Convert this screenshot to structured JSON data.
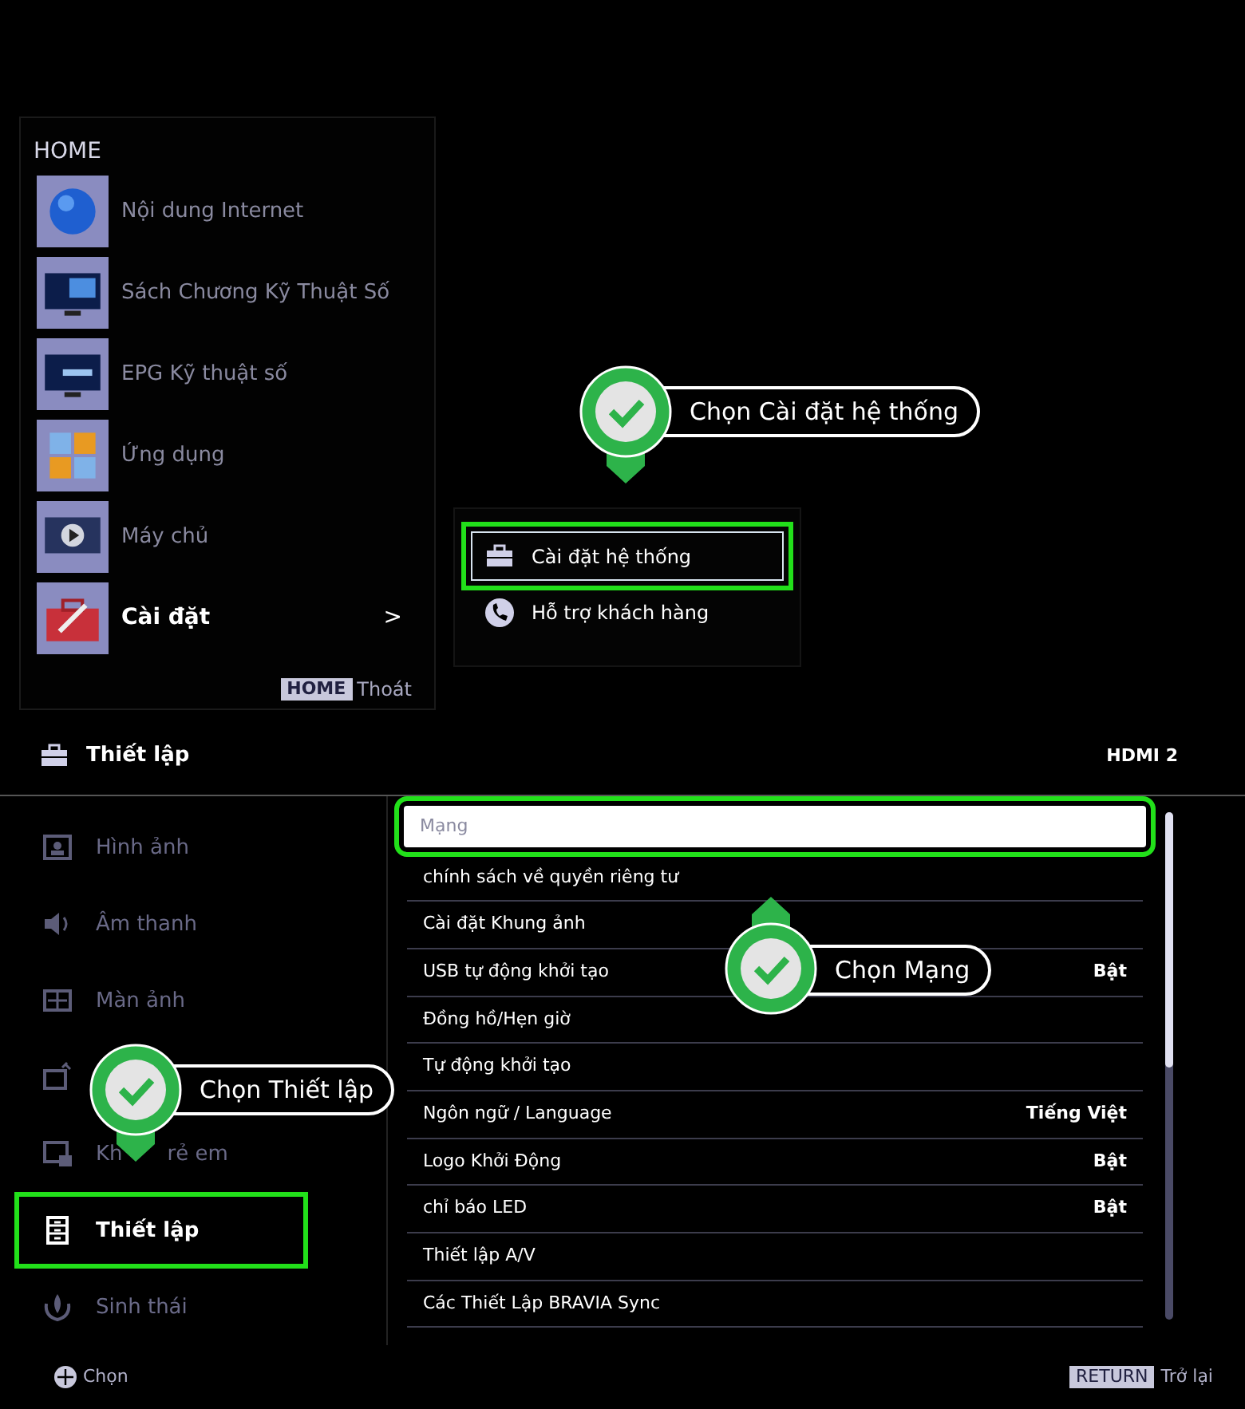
{
  "home_menu": {
    "title": "HOME",
    "items": [
      {
        "label": "Nội dung Internet",
        "selected": false
      },
      {
        "label": "Sách Chương Kỹ Thuật Số",
        "selected": false
      },
      {
        "label": "EPG Kỹ thuật số",
        "selected": false
      },
      {
        "label": "Ứng dụng",
        "selected": false
      },
      {
        "label": "Máy chủ",
        "selected": false
      },
      {
        "label": "Cài đặt",
        "selected": true,
        "chevron": ">"
      }
    ],
    "hint": {
      "key": "HOME",
      "label": "Thoát"
    }
  },
  "submenu": {
    "items": [
      {
        "label": "Cài đặt hệ thống",
        "selected": true,
        "highlighted": true
      },
      {
        "label": "Hỗ trợ khách hàng",
        "selected": false,
        "highlighted": false
      }
    ]
  },
  "settings": {
    "title": "Thiết lập",
    "input": "HDMI 2",
    "sidebar": [
      {
        "label_parts": [
          "Hình ảnh"
        ],
        "selected": false,
        "highlighted": false
      },
      {
        "label_parts": [
          "Âm thanh"
        ],
        "selected": false,
        "highlighted": false
      },
      {
        "label_parts": [
          "Màn ảnh"
        ],
        "selected": false,
        "highlighted": false
      },
      {
        "selected": false,
        "highlighted": false
      },
      {
        "label_parts": [
          "Kh",
          "rẻ em"
        ],
        "selected": false,
        "highlighted": false
      },
      {
        "label_parts": [
          "Thiết lập"
        ],
        "selected": true,
        "highlighted": true
      },
      {
        "label_parts": [
          "Sinh thái"
        ],
        "selected": false,
        "highlighted": false
      }
    ],
    "rows": [
      {
        "label": "Mạng",
        "selected": true,
        "highlighted": true
      },
      {
        "label": "chính sách về quyền riêng tư",
        "selected": false,
        "highlighted": false
      },
      {
        "label": "Cài đặt Khung ảnh",
        "selected": false,
        "highlighted": false
      },
      {
        "label": "USB tự động khởi tạo",
        "value": "Bật",
        "selected": false,
        "highlighted": false
      },
      {
        "label": "Đồng hồ/Hẹn giờ",
        "selected": false,
        "highlighted": false
      },
      {
        "label": "Tự động khởi tạo",
        "selected": false,
        "highlighted": false
      },
      {
        "label": "Ngôn ngữ / Language",
        "value": "Tiếng Việt",
        "selected": false,
        "highlighted": false
      },
      {
        "label": "Logo Khởi Động",
        "value": "Bật",
        "selected": false,
        "highlighted": false
      },
      {
        "label": "chỉ báo LED",
        "value": "Bật",
        "selected": false,
        "highlighted": false
      },
      {
        "label": "Thiết lập A/V",
        "selected": false,
        "highlighted": false
      },
      {
        "label": "Các Thiết Lập BRAVIA Sync",
        "selected": false,
        "highlighted": false
      }
    ],
    "footer": {
      "left": "Chọn",
      "key": "RETURN",
      "right": "Trở lại"
    }
  },
  "callouts": [
    {
      "text": "Chọn Cài đặt hệ thống",
      "kind": "down"
    },
    {
      "text": "Chọn Mạng",
      "kind": "up"
    },
    {
      "text": "Chọn Thiết lập",
      "kind": "down"
    }
  ]
}
